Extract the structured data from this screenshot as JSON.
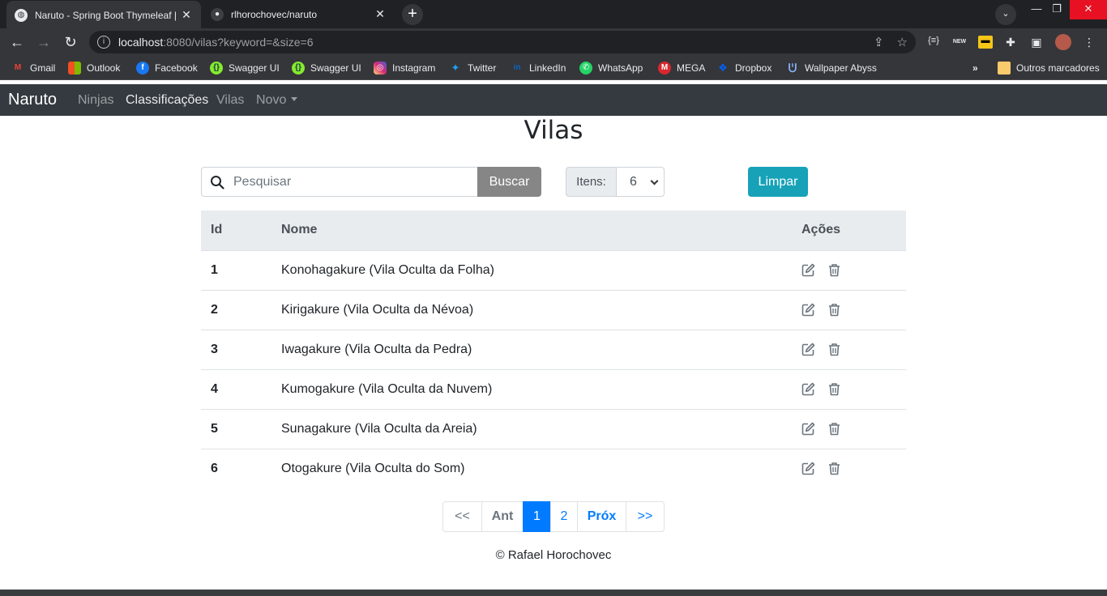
{
  "browser": {
    "tabs": [
      {
        "title": "Naruto - Spring Boot Thymeleaf |",
        "active": true
      },
      {
        "title": "rlhorochovec/naruto",
        "active": false
      }
    ],
    "url": {
      "host": "localhost",
      "rest": ":8080/vilas?keyword=&size=6"
    },
    "bookmarks": [
      {
        "label": "Gmail",
        "icon": "gmail-icon",
        "color": "#ea4335"
      },
      {
        "label": "Outlook",
        "icon": "microsoft-icon",
        "color": "#f25022"
      },
      {
        "label": "Facebook",
        "icon": "facebook-icon",
        "color": "#1877f2"
      },
      {
        "label": "Swagger UI",
        "icon": "swagger-icon",
        "color": "#85ea2d"
      },
      {
        "label": "Swagger UI",
        "icon": "swagger-icon",
        "color": "#85ea2d"
      },
      {
        "label": "Instagram",
        "icon": "instagram-icon",
        "color": "#e1306c"
      },
      {
        "label": "Twitter",
        "icon": "twitter-icon",
        "color": "#1da1f2"
      },
      {
        "label": "LinkedIn",
        "icon": "linkedin-icon",
        "color": "#0a66c2"
      },
      {
        "label": "WhatsApp",
        "icon": "whatsapp-icon",
        "color": "#25d366"
      },
      {
        "label": "MEGA",
        "icon": "mega-icon",
        "color": "#d9272e"
      },
      {
        "label": "Dropbox",
        "icon": "dropbox-icon",
        "color": "#0061ff"
      },
      {
        "label": "Wallpaper Abyss",
        "icon": "wallpaper-abyss-icon",
        "color": "#5b7bd5"
      }
    ],
    "other_bookmarks": "Outros marcadores",
    "ext_new": "NEW"
  },
  "navbar": {
    "brand": "Naruto",
    "links": [
      "Ninjas",
      "Classificações",
      "Vilas",
      "Novo"
    ]
  },
  "page": {
    "title": "Vilas",
    "search": {
      "placeholder": "Pesquisar",
      "button": "Buscar"
    },
    "items": {
      "label": "Itens:",
      "selected": "6"
    },
    "clear_button": "Limpar",
    "table": {
      "headers": [
        "Id",
        "Nome",
        "Ações"
      ],
      "rows": [
        {
          "id": "1",
          "nome": "Konohagakure (Vila Oculta da Folha)"
        },
        {
          "id": "2",
          "nome": "Kirigakure (Vila Oculta da Névoa)"
        },
        {
          "id": "3",
          "nome": "Iwagakure (Vila Oculta da Pedra)"
        },
        {
          "id": "4",
          "nome": "Kumogakure (Vila Oculta da Nuvem)"
        },
        {
          "id": "5",
          "nome": "Sunagakure (Vila Oculta da Areia)"
        },
        {
          "id": "6",
          "nome": "Otogakure (Vila Oculta do Som)"
        }
      ]
    },
    "pagination": {
      "first": "<<",
      "prev": "Ant",
      "pages": [
        "1",
        "2"
      ],
      "current": "1",
      "next": "Próx",
      "last": ">>"
    },
    "footer": "© Rafael Horochovec"
  },
  "colors": {
    "navbar": "#343a40",
    "primary": "#007bff",
    "info": "#17a2b8",
    "search_button": "#868686"
  }
}
